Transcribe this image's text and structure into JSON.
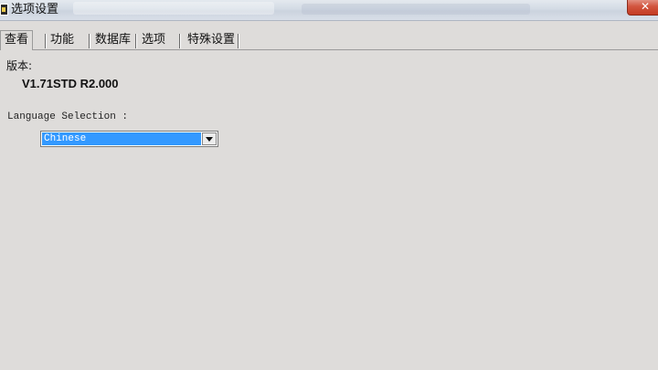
{
  "window": {
    "title": "选项设置",
    "close_label": "✕"
  },
  "tabs": [
    {
      "label": "查看",
      "active": true
    },
    {
      "label": "功能",
      "active": false
    },
    {
      "label": "数据库",
      "active": false
    },
    {
      "label": "选项",
      "active": false
    },
    {
      "label": "特殊设置",
      "active": false
    }
  ],
  "version": {
    "label": "版本:",
    "value": "V1.71STD R2.000"
  },
  "language": {
    "label": "Language Selection :",
    "selected": "Chinese"
  },
  "colors": {
    "selection_highlight": "#3399ff",
    "close_button": "#d2553f",
    "window_bg": "#dedcda"
  }
}
